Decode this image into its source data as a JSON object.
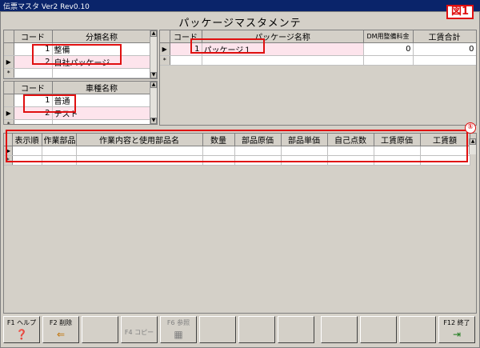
{
  "window": {
    "title": "伝票マスタ Ver2 Rev0.10"
  },
  "page_title": "パッケージマスタメンテ",
  "badge": "図1",
  "callout": "①",
  "category_grid": {
    "headers": [
      "コード",
      "分類名称"
    ],
    "rows": [
      {
        "marker": "",
        "code": "1",
        "name": "整備"
      },
      {
        "marker": "▶",
        "code": "2",
        "name": "自社パッケージ"
      },
      {
        "marker": "*",
        "code": "",
        "name": ""
      }
    ]
  },
  "vehicle_grid": {
    "headers": [
      "コード",
      "車種名称"
    ],
    "rows": [
      {
        "marker": "",
        "code": "1",
        "name": "普通"
      },
      {
        "marker": "▶",
        "code": "2",
        "name": "テスト"
      },
      {
        "marker": "*",
        "code": "",
        "name": ""
      }
    ]
  },
  "package_grid": {
    "headers": [
      "コード",
      "パッケージ名称",
      "DM用整備料金",
      "工賃合計"
    ],
    "rows": [
      {
        "marker": "▶",
        "code": "1",
        "name": "パッケージ１",
        "dm_fee": "0",
        "labor_total": "0"
      },
      {
        "marker": "*",
        "code": "",
        "name": "",
        "dm_fee": "",
        "labor_total": ""
      }
    ]
  },
  "detail_grid": {
    "headers": [
      "表示順",
      "作業部品",
      "作業内容と使用部品名",
      "数量",
      "部品原価",
      "部品単価",
      "自己点数",
      "工賃原価",
      "工賃額"
    ],
    "rows": [
      {
        "marker": "▶"
      },
      {
        "marker": "*"
      }
    ]
  },
  "function_keys": [
    {
      "label": "F1 ヘルプ",
      "icon": "help-icon",
      "glyph": "❓",
      "enabled": true
    },
    {
      "label": "F2 削除",
      "icon": "delete-icon",
      "glyph": "⇐",
      "enabled": true
    },
    {
      "label": "",
      "icon": "",
      "glyph": "",
      "enabled": false
    },
    {
      "label": "F4 コピー",
      "icon": "",
      "glyph": "",
      "enabled": false
    },
    {
      "label": "F6 参照",
      "icon": "reference-icon",
      "glyph": "▦",
      "enabled": false
    },
    {
      "label": "",
      "icon": "",
      "glyph": "",
      "enabled": false
    },
    {
      "label": "",
      "icon": "",
      "glyph": "",
      "enabled": false
    },
    {
      "label": "",
      "icon": "",
      "glyph": "",
      "enabled": false
    },
    {
      "label": "",
      "icon": "",
      "glyph": "",
      "enabled": false
    },
    {
      "label": "",
      "icon": "",
      "glyph": "",
      "enabled": false
    },
    {
      "label": "",
      "icon": "",
      "glyph": "",
      "enabled": false
    },
    {
      "label": "F12 終了",
      "icon": "exit-icon",
      "glyph": "⇥",
      "enabled": true
    }
  ],
  "colors": {
    "accent_red": "#e01010",
    "titlebar": "#0a246a",
    "row_highlight": "#fde4ec"
  }
}
